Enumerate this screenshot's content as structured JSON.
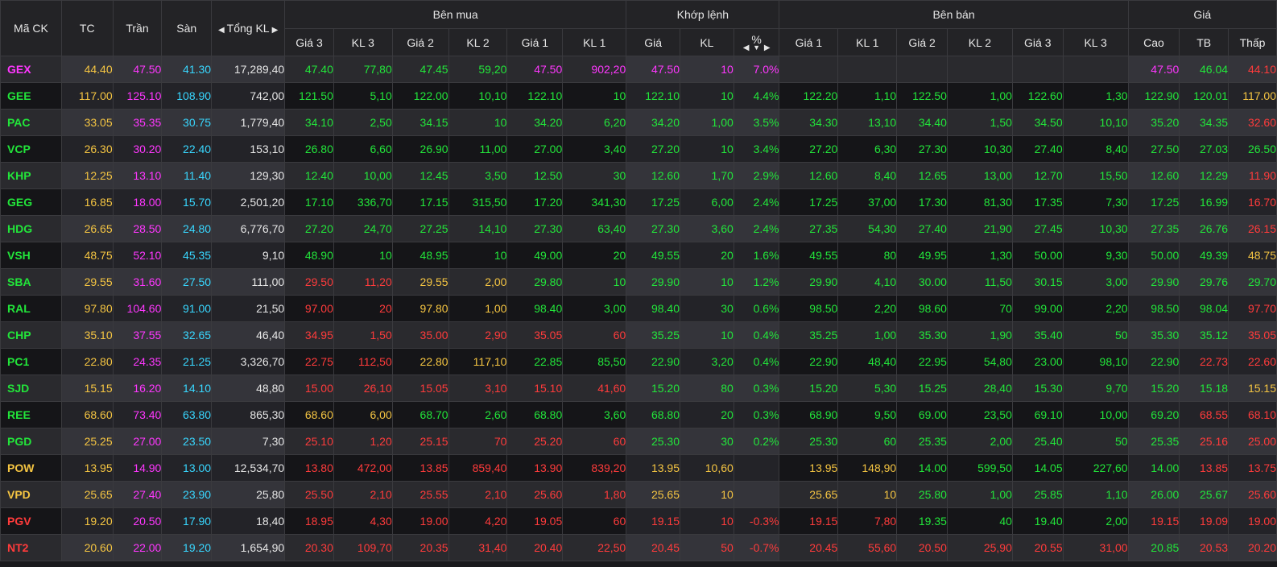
{
  "colors": {
    "up": "#22e53a",
    "down": "#ff3b3b",
    "ref": "#f5c542",
    "ceil": "#ff37ff",
    "floor": "#38d7ff",
    "white": "#e6e6e6"
  },
  "header": {
    "symbol": "Mã CK",
    "ref": "TC",
    "ceiling": "Trần",
    "floor": "Sàn",
    "total_vol": "Tổng KL",
    "buy_group": "Bên mua",
    "match_group": "Khớp lệnh",
    "sell_group": "Bên bán",
    "price_group": "Giá",
    "buy_cols": [
      "Giá 3",
      "KL 3",
      "Giá 2",
      "KL 2",
      "Giá 1",
      "KL 1"
    ],
    "match_cols": [
      "Giá",
      "KL",
      "%"
    ],
    "sell_cols": [
      "Giá 1",
      "KL 1",
      "Giá 2",
      "KL 2",
      "Giá 3",
      "KL 3"
    ],
    "price_cols": [
      "Cao",
      "TB",
      "Thấp"
    ]
  },
  "rows": [
    {
      "c": [
        "GEX",
        "44.40",
        "47.50",
        "41.30",
        "17,289,40",
        "47.40",
        "77,80",
        "47.45",
        "59,20",
        "47.50",
        "902,20",
        "47.50",
        "10",
        "7.0%",
        "",
        "",
        "",
        "",
        "",
        "",
        "47.50",
        "46.04",
        "44.10"
      ],
      "k": [
        "ceil",
        "ref",
        "ceil",
        "floor",
        "white",
        "up",
        "up",
        "up",
        "up",
        "ceil",
        "ceil",
        "ceil",
        "ceil",
        "ceil",
        "up",
        "up",
        "up",
        "up",
        "up",
        "up",
        "ceil",
        "up",
        "down"
      ]
    },
    {
      "c": [
        "GEE",
        "117.00",
        "125.10",
        "108.90",
        "742,00",
        "121.50",
        "5,10",
        "122.00",
        "10,10",
        "122.10",
        "10",
        "122.10",
        "10",
        "4.4%",
        "122.20",
        "1,10",
        "122.50",
        "1,00",
        "122.60",
        "1,30",
        "122.90",
        "120.01",
        "117.00"
      ],
      "k": [
        "up",
        "ref",
        "ceil",
        "floor",
        "white",
        "up",
        "up",
        "up",
        "up",
        "up",
        "up",
        "up",
        "up",
        "up",
        "up",
        "up",
        "up",
        "up",
        "up",
        "up",
        "up",
        "up",
        "ref"
      ]
    },
    {
      "c": [
        "PAC",
        "33.05",
        "35.35",
        "30.75",
        "1,779,40",
        "34.10",
        "2,50",
        "34.15",
        "10",
        "34.20",
        "6,20",
        "34.20",
        "1,00",
        "3.5%",
        "34.30",
        "13,10",
        "34.40",
        "1,50",
        "34.50",
        "10,10",
        "35.20",
        "34.35",
        "32.60"
      ],
      "k": [
        "up",
        "ref",
        "ceil",
        "floor",
        "white",
        "up",
        "up",
        "up",
        "up",
        "up",
        "up",
        "up",
        "up",
        "up",
        "up",
        "up",
        "up",
        "up",
        "up",
        "up",
        "up",
        "up",
        "down"
      ]
    },
    {
      "c": [
        "VCP",
        "26.30",
        "30.20",
        "22.40",
        "153,10",
        "26.80",
        "6,60",
        "26.90",
        "11,00",
        "27.00",
        "3,40",
        "27.20",
        "10",
        "3.4%",
        "27.20",
        "6,30",
        "27.30",
        "10,30",
        "27.40",
        "8,40",
        "27.50",
        "27.03",
        "26.50"
      ],
      "k": [
        "up",
        "ref",
        "ceil",
        "floor",
        "white",
        "up",
        "up",
        "up",
        "up",
        "up",
        "up",
        "up",
        "up",
        "up",
        "up",
        "up",
        "up",
        "up",
        "up",
        "up",
        "up",
        "up",
        "up"
      ]
    },
    {
      "c": [
        "KHP",
        "12.25",
        "13.10",
        "11.40",
        "129,30",
        "12.40",
        "10,00",
        "12.45",
        "3,50",
        "12.50",
        "30",
        "12.60",
        "1,70",
        "2.9%",
        "12.60",
        "8,40",
        "12.65",
        "13,00",
        "12.70",
        "15,50",
        "12.60",
        "12.29",
        "11.90"
      ],
      "k": [
        "up",
        "ref",
        "ceil",
        "floor",
        "white",
        "up",
        "up",
        "up",
        "up",
        "up",
        "up",
        "up",
        "up",
        "up",
        "up",
        "up",
        "up",
        "up",
        "up",
        "up",
        "up",
        "up",
        "down"
      ]
    },
    {
      "c": [
        "GEG",
        "16.85",
        "18.00",
        "15.70",
        "2,501,20",
        "17.10",
        "336,70",
        "17.15",
        "315,50",
        "17.20",
        "341,30",
        "17.25",
        "6,00",
        "2.4%",
        "17.25",
        "37,00",
        "17.30",
        "81,30",
        "17.35",
        "7,30",
        "17.25",
        "16.99",
        "16.70"
      ],
      "k": [
        "up",
        "ref",
        "ceil",
        "floor",
        "white",
        "up",
        "up",
        "up",
        "up",
        "up",
        "up",
        "up",
        "up",
        "up",
        "up",
        "up",
        "up",
        "up",
        "up",
        "up",
        "up",
        "up",
        "down"
      ]
    },
    {
      "c": [
        "HDG",
        "26.65",
        "28.50",
        "24.80",
        "6,776,70",
        "27.20",
        "24,70",
        "27.25",
        "14,10",
        "27.30",
        "63,40",
        "27.30",
        "3,60",
        "2.4%",
        "27.35",
        "54,30",
        "27.40",
        "21,90",
        "27.45",
        "10,30",
        "27.35",
        "26.76",
        "26.15"
      ],
      "k": [
        "up",
        "ref",
        "ceil",
        "floor",
        "white",
        "up",
        "up",
        "up",
        "up",
        "up",
        "up",
        "up",
        "up",
        "up",
        "up",
        "up",
        "up",
        "up",
        "up",
        "up",
        "up",
        "up",
        "down"
      ]
    },
    {
      "c": [
        "VSH",
        "48.75",
        "52.10",
        "45.35",
        "9,10",
        "48.90",
        "10",
        "48.95",
        "10",
        "49.00",
        "20",
        "49.55",
        "20",
        "1.6%",
        "49.55",
        "80",
        "49.95",
        "1,30",
        "50.00",
        "9,30",
        "50.00",
        "49.39",
        "48.75"
      ],
      "k": [
        "up",
        "ref",
        "ceil",
        "floor",
        "white",
        "up",
        "up",
        "up",
        "up",
        "up",
        "up",
        "up",
        "up",
        "up",
        "up",
        "up",
        "up",
        "up",
        "up",
        "up",
        "up",
        "up",
        "ref"
      ]
    },
    {
      "c": [
        "SBA",
        "29.55",
        "31.60",
        "27.50",
        "111,00",
        "29.50",
        "11,20",
        "29.55",
        "2,00",
        "29.80",
        "10",
        "29.90",
        "10",
        "1.2%",
        "29.90",
        "4,10",
        "30.00",
        "11,50",
        "30.15",
        "3,00",
        "29.90",
        "29.76",
        "29.70"
      ],
      "k": [
        "up",
        "ref",
        "ceil",
        "floor",
        "white",
        "down",
        "down",
        "ref",
        "ref",
        "up",
        "up",
        "up",
        "up",
        "up",
        "up",
        "up",
        "up",
        "up",
        "up",
        "up",
        "up",
        "up",
        "up"
      ]
    },
    {
      "c": [
        "RAL",
        "97.80",
        "104.60",
        "91.00",
        "21,50",
        "97.00",
        "20",
        "97.80",
        "1,00",
        "98.40",
        "3,00",
        "98.40",
        "30",
        "0.6%",
        "98.50",
        "2,20",
        "98.60",
        "70",
        "99.00",
        "2,20",
        "98.50",
        "98.04",
        "97.70"
      ],
      "k": [
        "up",
        "ref",
        "ceil",
        "floor",
        "white",
        "down",
        "down",
        "ref",
        "ref",
        "up",
        "up",
        "up",
        "up",
        "up",
        "up",
        "up",
        "up",
        "up",
        "up",
        "up",
        "up",
        "up",
        "down"
      ]
    },
    {
      "c": [
        "CHP",
        "35.10",
        "37.55",
        "32.65",
        "46,40",
        "34.95",
        "1,50",
        "35.00",
        "2,90",
        "35.05",
        "60",
        "35.25",
        "10",
        "0.4%",
        "35.25",
        "1,00",
        "35.30",
        "1,90",
        "35.40",
        "50",
        "35.30",
        "35.12",
        "35.05"
      ],
      "k": [
        "up",
        "ref",
        "ceil",
        "floor",
        "white",
        "down",
        "down",
        "down",
        "down",
        "down",
        "down",
        "up",
        "up",
        "up",
        "up",
        "up",
        "up",
        "up",
        "up",
        "up",
        "up",
        "up",
        "down"
      ]
    },
    {
      "c": [
        "PC1",
        "22.80",
        "24.35",
        "21.25",
        "3,326,70",
        "22.75",
        "112,50",
        "22.80",
        "117,10",
        "22.85",
        "85,50",
        "22.90",
        "3,20",
        "0.4%",
        "22.90",
        "48,40",
        "22.95",
        "54,80",
        "23.00",
        "98,10",
        "22.90",
        "22.73",
        "22.60"
      ],
      "k": [
        "up",
        "ref",
        "ceil",
        "floor",
        "white",
        "down",
        "down",
        "ref",
        "ref",
        "up",
        "up",
        "up",
        "up",
        "up",
        "up",
        "up",
        "up",
        "up",
        "up",
        "up",
        "up",
        "down",
        "down"
      ]
    },
    {
      "c": [
        "SJD",
        "15.15",
        "16.20",
        "14.10",
        "48,80",
        "15.00",
        "26,10",
        "15.05",
        "3,10",
        "15.10",
        "41,60",
        "15.20",
        "80",
        "0.3%",
        "15.20",
        "5,30",
        "15.25",
        "28,40",
        "15.30",
        "9,70",
        "15.20",
        "15.18",
        "15.15"
      ],
      "k": [
        "up",
        "ref",
        "ceil",
        "floor",
        "white",
        "down",
        "down",
        "down",
        "down",
        "down",
        "down",
        "up",
        "up",
        "up",
        "up",
        "up",
        "up",
        "up",
        "up",
        "up",
        "up",
        "up",
        "ref"
      ]
    },
    {
      "c": [
        "REE",
        "68.60",
        "73.40",
        "63.80",
        "865,30",
        "68.60",
        "6,00",
        "68.70",
        "2,60",
        "68.80",
        "3,60",
        "68.80",
        "20",
        "0.3%",
        "68.90",
        "9,50",
        "69.00",
        "23,50",
        "69.10",
        "10,00",
        "69.20",
        "68.55",
        "68.10"
      ],
      "k": [
        "up",
        "ref",
        "ceil",
        "floor",
        "white",
        "ref",
        "ref",
        "up",
        "up",
        "up",
        "up",
        "up",
        "up",
        "up",
        "up",
        "up",
        "up",
        "up",
        "up",
        "up",
        "up",
        "down",
        "down"
      ]
    },
    {
      "c": [
        "PGD",
        "25.25",
        "27.00",
        "23.50",
        "7,30",
        "25.10",
        "1,20",
        "25.15",
        "70",
        "25.20",
        "60",
        "25.30",
        "30",
        "0.2%",
        "25.30",
        "60",
        "25.35",
        "2,00",
        "25.40",
        "50",
        "25.35",
        "25.16",
        "25.00"
      ],
      "k": [
        "up",
        "ref",
        "ceil",
        "floor",
        "white",
        "down",
        "down",
        "down",
        "down",
        "down",
        "down",
        "up",
        "up",
        "up",
        "up",
        "up",
        "up",
        "up",
        "up",
        "up",
        "up",
        "down",
        "down"
      ]
    },
    {
      "c": [
        "POW",
        "13.95",
        "14.90",
        "13.00",
        "12,534,70",
        "13.80",
        "472,00",
        "13.85",
        "859,40",
        "13.90",
        "839,20",
        "13.95",
        "10,60",
        "",
        "13.95",
        "148,90",
        "14.00",
        "599,50",
        "14.05",
        "227,60",
        "14.00",
        "13.85",
        "13.75"
      ],
      "k": [
        "ref",
        "ref",
        "ceil",
        "floor",
        "white",
        "down",
        "down",
        "down",
        "down",
        "down",
        "down",
        "ref",
        "ref",
        "ref",
        "ref",
        "ref",
        "up",
        "up",
        "up",
        "up",
        "up",
        "down",
        "down"
      ]
    },
    {
      "c": [
        "VPD",
        "25.65",
        "27.40",
        "23.90",
        "25,80",
        "25.50",
        "2,10",
        "25.55",
        "2,10",
        "25.60",
        "1,80",
        "25.65",
        "10",
        "",
        "25.65",
        "10",
        "25.80",
        "1,00",
        "25.85",
        "1,10",
        "26.00",
        "25.67",
        "25.60"
      ],
      "k": [
        "ref",
        "ref",
        "ceil",
        "floor",
        "white",
        "down",
        "down",
        "down",
        "down",
        "down",
        "down",
        "ref",
        "ref",
        "ref",
        "ref",
        "ref",
        "up",
        "up",
        "up",
        "up",
        "up",
        "up",
        "down"
      ]
    },
    {
      "c": [
        "PGV",
        "19.20",
        "20.50",
        "17.90",
        "18,40",
        "18.95",
        "4,30",
        "19.00",
        "4,20",
        "19.05",
        "60",
        "19.15",
        "10",
        "-0.3%",
        "19.15",
        "7,80",
        "19.35",
        "40",
        "19.40",
        "2,00",
        "19.15",
        "19.09",
        "19.00"
      ],
      "k": [
        "down",
        "ref",
        "ceil",
        "floor",
        "white",
        "down",
        "down",
        "down",
        "down",
        "down",
        "down",
        "down",
        "down",
        "down",
        "down",
        "down",
        "up",
        "up",
        "up",
        "up",
        "down",
        "down",
        "down"
      ]
    },
    {
      "c": [
        "NT2",
        "20.60",
        "22.00",
        "19.20",
        "1,654,90",
        "20.30",
        "109,70",
        "20.35",
        "31,40",
        "20.40",
        "22,50",
        "20.45",
        "50",
        "-0.7%",
        "20.45",
        "55,60",
        "20.50",
        "25,90",
        "20.55",
        "31,00",
        "20.85",
        "20.53",
        "20.20"
      ],
      "k": [
        "down",
        "ref",
        "ceil",
        "floor",
        "white",
        "down",
        "down",
        "down",
        "down",
        "down",
        "down",
        "down",
        "down",
        "down",
        "down",
        "down",
        "down",
        "down",
        "down",
        "down",
        "up",
        "down",
        "down"
      ]
    }
  ]
}
